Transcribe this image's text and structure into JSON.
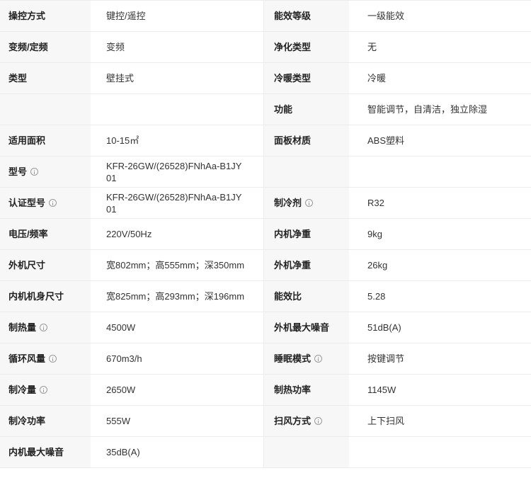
{
  "rows": [
    {
      "l_label": "操控方式",
      "l_value": "键控/遥控",
      "r_label": "能效等级",
      "r_value": "一级能效"
    },
    {
      "l_label": "变频/定频",
      "l_value": "变频",
      "r_label": "净化类型",
      "r_value": "无"
    },
    {
      "l_label": "类型",
      "l_value": "壁挂式",
      "r_label": "冷暖类型",
      "r_value": "冷暖"
    },
    {
      "l_label": "",
      "l_value": "",
      "r_label": "功能",
      "r_value": "智能调节，自清洁，独立除湿"
    },
    {
      "l_label": "适用面积",
      "l_value": "10-15㎡",
      "r_label": "面板材质",
      "r_value": "ABS塑料"
    },
    {
      "l_label": "型号",
      "l_value": "KFR-26GW/(26528)FNhAa-B1JY01",
      "r_label": "",
      "r_value": ""
    },
    {
      "l_label": "认证型号",
      "l_value": "KFR-26GW/(26528)FNhAa-B1JY01",
      "r_label": "制冷剂",
      "r_value": "R32"
    },
    {
      "l_label": "电压/频率",
      "l_value": "220V/50Hz",
      "r_label": "内机净重",
      "r_value": "9kg"
    },
    {
      "l_label": "外机尺寸",
      "l_value": "宽802mm；高555mm；深350mm",
      "r_label": "外机净重",
      "r_value": "26kg"
    },
    {
      "l_label": "内机机身尺寸",
      "l_value": "宽825mm；高293mm；深196mm",
      "r_label": "能效比",
      "r_value": "5.28"
    },
    {
      "l_label": "制热量",
      "l_value": "4500W",
      "r_label": "外机最大噪音",
      "r_value": "51dB(A)"
    },
    {
      "l_label": "循环风量",
      "l_value": "670m3/h",
      "r_label": "睡眠模式",
      "r_value": "按键调节"
    },
    {
      "l_label": "制冷量",
      "l_value": "2650W",
      "r_label": "制热功率",
      "r_value": "1145W"
    },
    {
      "l_label": "制冷功率",
      "l_value": "555W",
      "r_label": "扫风方式",
      "r_value": "上下扫风"
    },
    {
      "l_label": "内机最大噪音",
      "l_value": "35dB(A)",
      "r_label": "",
      "r_value": ""
    }
  ],
  "icons": {
    "info": "info-circle-icon"
  }
}
